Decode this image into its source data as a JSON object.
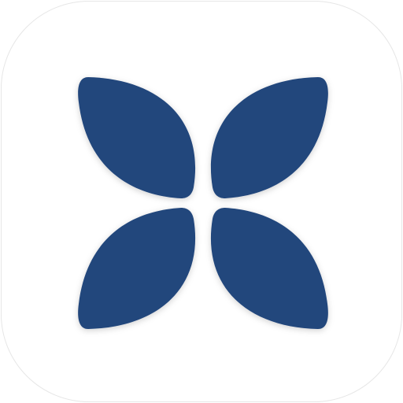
{
  "app_icon": {
    "logo_icon": "four-petal-leaf-logo-icon",
    "colors": {
      "background": "#ffffff",
      "border": "#e6e6e6",
      "petal": "#23467c",
      "shadow": "#000000"
    }
  }
}
